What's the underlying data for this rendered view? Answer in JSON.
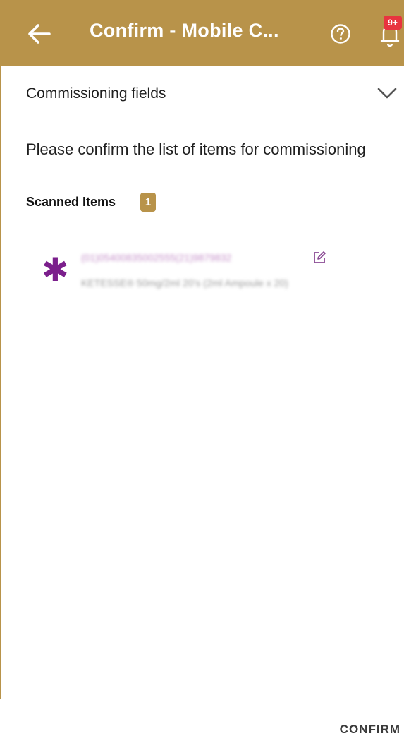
{
  "app_bar": {
    "title": "Confirm - Mobile C...",
    "back_icon": "arrow-left-icon",
    "help_icon": "help-circle-icon",
    "bell_icon": "bell-icon",
    "notification_count": "9+",
    "background_color": "#b8934a"
  },
  "section": {
    "title": "Commissioning fields",
    "toggle_icon": "chevron-down-icon"
  },
  "instruction": "Please confirm the list of items for commissioning",
  "scanned": {
    "label": "Scanned Items",
    "count": "1",
    "items": [
      {
        "icon": "asterisk-icon",
        "code": "(01)05400835002555(21)9879832",
        "description": "KETESSE® 50mg/2ml 20's (2ml Ampoule x 20)",
        "edit_icon": "edit-icon"
      }
    ]
  },
  "footer": {
    "confirm_label": "CONFIRM"
  }
}
